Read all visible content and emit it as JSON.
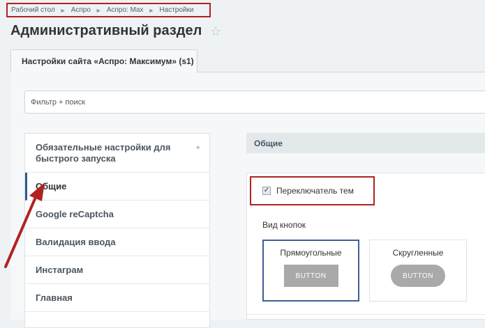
{
  "breadcrumb": {
    "items": [
      "Рабочий стол",
      "Аспро",
      "Аспро: Max",
      "Настройки"
    ],
    "separator": "►"
  },
  "page": {
    "title": "Административный раздел",
    "favorite_icon": "star-icon"
  },
  "tabs": [
    {
      "label": "Настройки сайта «Аспро: Максимум» (s1)",
      "active": true
    }
  ],
  "filter": {
    "placeholder": "Фильтр + поиск",
    "value": ""
  },
  "sidebar": {
    "items": [
      {
        "label": "Обязательные настройки для быстрого запуска",
        "required_mark": "*"
      },
      {
        "label": "Общие",
        "active": true
      },
      {
        "label": "Google reCaptcha"
      },
      {
        "label": "Валидация ввода"
      },
      {
        "label": "Инстаграм"
      },
      {
        "label": "Главная"
      }
    ]
  },
  "section": {
    "title": "Общие",
    "theme_switcher": {
      "label": "Переключатель тем",
      "checked": true
    },
    "button_view": {
      "label": "Вид кнопок",
      "options": [
        {
          "label": "Прямоугольные",
          "preview": "BUTTON",
          "selected": true
        },
        {
          "label": "Скругленные",
          "preview": "BUTTON",
          "selected": false
        }
      ]
    }
  },
  "colors": {
    "highlight_border": "#b02222",
    "accent": "#3c5f94",
    "preview_button": "#a9a9a9"
  }
}
